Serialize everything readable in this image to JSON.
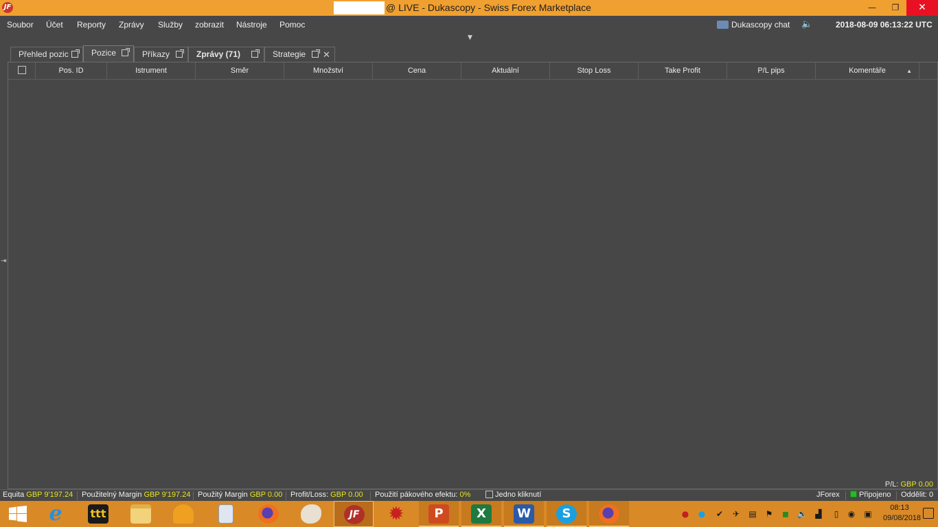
{
  "window": {
    "title": "@ LIVE - Dukascopy - Swiss Forex Marketplace",
    "minimize_glyph": "—",
    "maximize_glyph": "❐",
    "close_glyph": "✕"
  },
  "menubar": {
    "items": [
      "Soubor",
      "Účet",
      "Reporty",
      "Zprávy",
      "Služby",
      "zobrazit",
      "Nástroje",
      "Pomoc"
    ],
    "chat_label": "Dukascopy chat",
    "clock": "2018-08-09 06:13:22 UTC"
  },
  "tabs": [
    {
      "label": "Přehled pozic"
    },
    {
      "label": "Pozice"
    },
    {
      "label": "Příkazy"
    },
    {
      "label": "Zprávy (71)"
    },
    {
      "label": "Strategie"
    }
  ],
  "table": {
    "columns": [
      "Pos. ID",
      "Istrument",
      "Směr",
      "Množství",
      "Cena",
      "Aktuální",
      "Stop Loss",
      "Take Profit",
      "P/L pips",
      "Komentáře"
    ],
    "rows": []
  },
  "pl_footer": {
    "label": "P/L:",
    "value": "GBP 0.00"
  },
  "statusbar": {
    "equity_label": "Equita",
    "equity_value": "GBP 9'197.24",
    "usable_margin_label": "Použitelný Margin",
    "usable_margin_value": "GBP 9'197.24",
    "used_margin_label": "Použitý Margin",
    "used_margin_value": "GBP 0.00",
    "profit_loss_label": "Profit/Loss:",
    "profit_loss_value": "GBP 0.00",
    "leverage_label": "Použití pákového efektu:",
    "leverage_value": "0%",
    "one_click_label": "Jedno kliknutí",
    "platform": "JForex",
    "connection": "Připojeno",
    "detached_label": "Oddělit: 0"
  },
  "taskbar": {
    "time": "08:13",
    "date": "09/08/2018",
    "apps": [
      "windows-start",
      "internet-explorer",
      "broker-app",
      "file-explorer",
      "sirius",
      "calculator",
      "firefox",
      "paint",
      "jforex",
      "red-gear-app",
      "powerpoint",
      "excel",
      "word",
      "skype",
      "firefox-2"
    ]
  },
  "colors": {
    "titlebar": "#f0a030",
    "background": "#474747",
    "value_yellow": "#e7e320",
    "taskbar": "#d98a27",
    "connected_green": "#2db52d"
  }
}
